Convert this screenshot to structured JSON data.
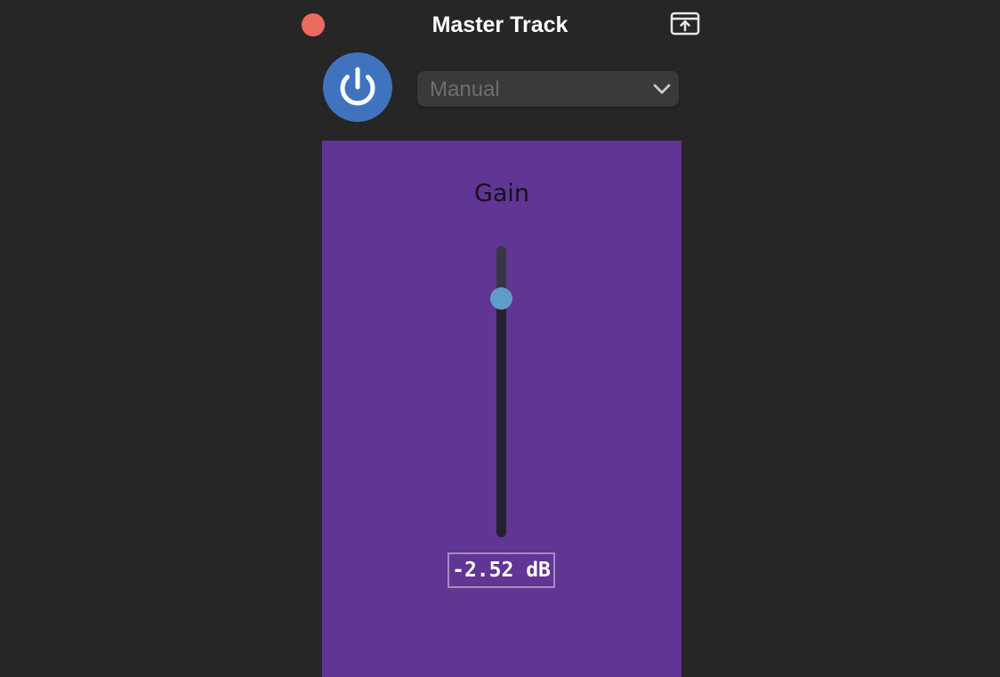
{
  "window": {
    "title": "Master Track"
  },
  "controls": {
    "power_state": "on",
    "preset": {
      "selected": "Manual"
    }
  },
  "plugin": {
    "param_label": "Gain",
    "value_text": "-2.52 dB",
    "value_db": -2.52,
    "slider_fraction": 0.82
  },
  "colors": {
    "background": "#262626",
    "close_button": "#ec6a5e",
    "power_button": "#3f73bd",
    "panel": "#613593",
    "slider_thumb": "#5f9cc9"
  },
  "icons": {
    "close": "close-icon",
    "popout": "popout-icon",
    "power": "power-icon",
    "chevron": "chevron-down-icon"
  }
}
